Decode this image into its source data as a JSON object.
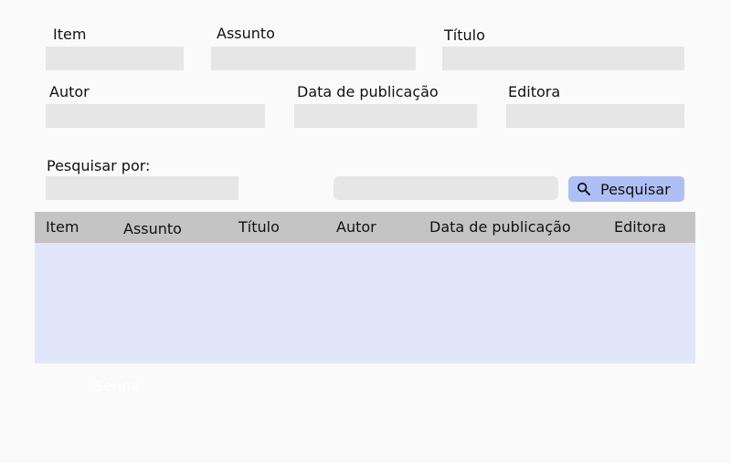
{
  "form": {
    "item_label": "Item",
    "assunto_label": "Assunto",
    "titulo_label": "Título",
    "autor_label": "Autor",
    "data_label": "Data de publicação",
    "editora_label": "Editora",
    "pesquisar_por_label": "Pesquisar por:",
    "item_value": "",
    "assunto_value": "",
    "titulo_value": "",
    "autor_value": "",
    "data_value": "",
    "editora_value": "",
    "search_by_value": "",
    "search_query_value": ""
  },
  "search_button": {
    "label": "Pesquisar",
    "icon": "search-icon"
  },
  "table": {
    "columns": [
      "Item",
      "Assunto",
      "Título",
      "Autor",
      "Data de publicação",
      "Editora"
    ],
    "rows": []
  },
  "footer": {
    "hidden_text": "Senha"
  }
}
